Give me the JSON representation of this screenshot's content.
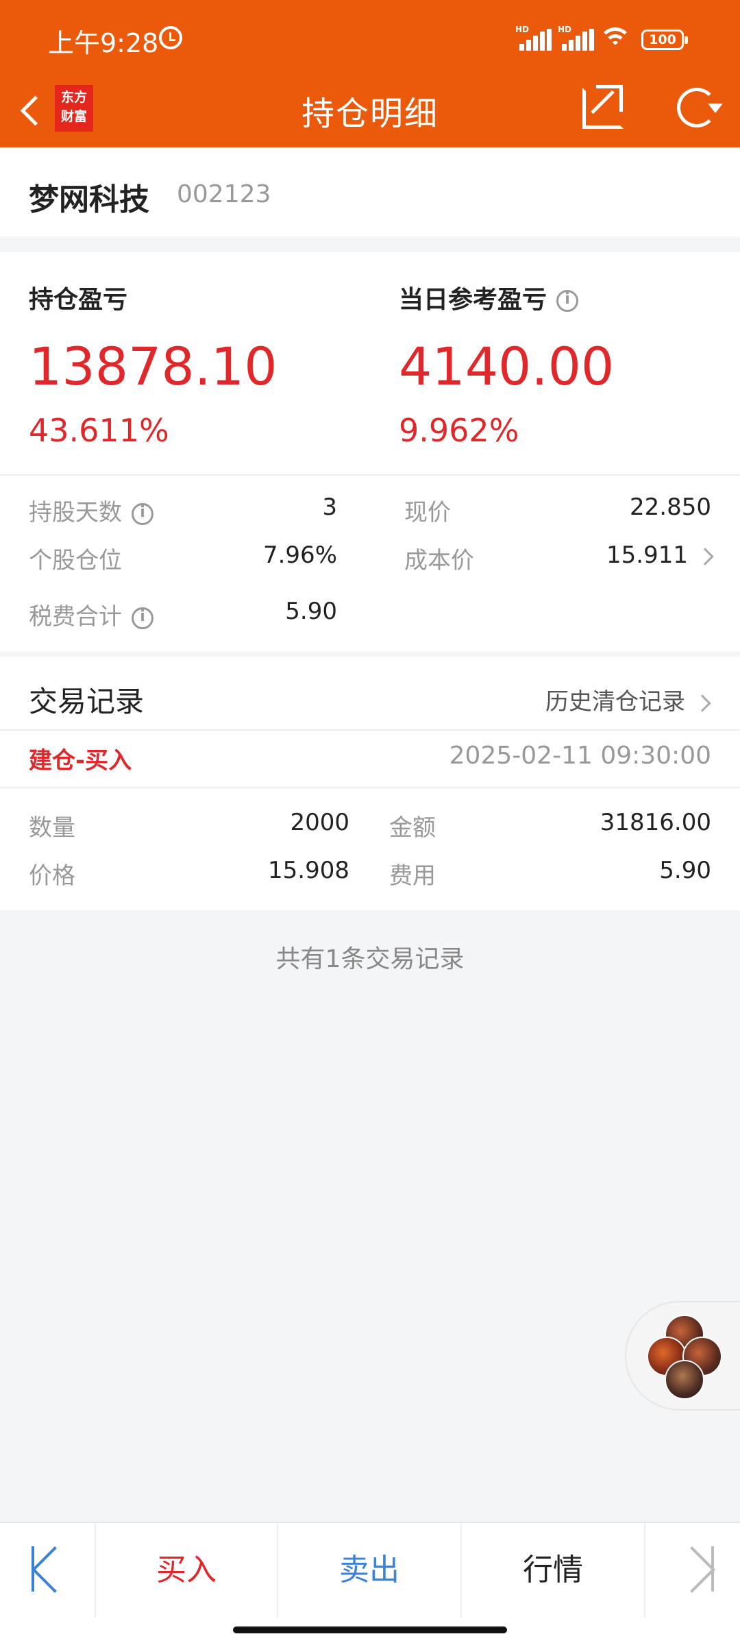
{
  "status_bar": {
    "time": "上午9:28",
    "battery": "100"
  },
  "header": {
    "logo_line1": "东方",
    "logo_line2": "财富",
    "title": "持仓明细"
  },
  "stock": {
    "name": "梦网科技",
    "code": "002123"
  },
  "pnl": {
    "position_label": "持仓盈亏",
    "position_value": "13878.10",
    "position_pct": "43.611%",
    "daily_label": "当日参考盈亏",
    "daily_value": "4140.00",
    "daily_pct": "9.962%"
  },
  "details": {
    "days_label": "持股天数",
    "days_value": "3",
    "price_label": "现价",
    "price_value": "22.850",
    "weight_label": "个股仓位",
    "weight_value": "7.96%",
    "cost_label": "成本价",
    "cost_value": "15.911",
    "fee_label": "税费合计",
    "fee_value": "5.90"
  },
  "trades": {
    "title": "交易记录",
    "history_link": "历史清仓记录",
    "records": [
      {
        "type": "建仓-买入",
        "time": "2025-02-11 09:30:00",
        "qty_label": "数量",
        "qty": "2000",
        "amount_label": "金额",
        "amount": "31816.00",
        "price_label": "价格",
        "price": "15.908",
        "fee_label": "费用",
        "fee": "5.90"
      }
    ],
    "summary": "共有1条交易记录"
  },
  "bottom_bar": {
    "buy": "买入",
    "sell": "卖出",
    "quote": "行情"
  },
  "colors": {
    "header": "#ea5a0a",
    "up_red": "#e0272a",
    "sell_blue": "#3b82d6"
  }
}
